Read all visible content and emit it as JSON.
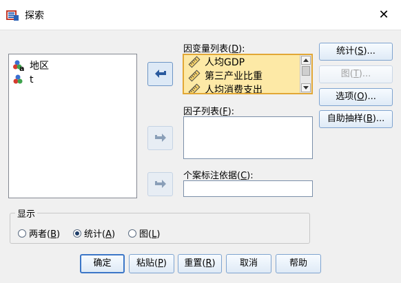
{
  "window": {
    "title": "探索",
    "close_glyph": "✕"
  },
  "source_list": {
    "items": [
      {
        "label": "地区",
        "icon": "nominal-string-variable-icon"
      },
      {
        "label": "t",
        "icon": "nominal-variable-icon"
      }
    ]
  },
  "dependent": {
    "label_pre": "因变量列表(",
    "label_key": "D",
    "label_post": "):",
    "items": [
      {
        "label": "人均GDP",
        "icon": "scale-variable-icon"
      },
      {
        "label": "第三产业比重",
        "icon": "scale-variable-icon"
      },
      {
        "label": "人均消费支出",
        "icon": "scale-variable-icon"
      }
    ]
  },
  "factor": {
    "label_pre": "因子列表(",
    "label_key": "F",
    "label_post": "):"
  },
  "case_label": {
    "label_pre": "个案标注依据(",
    "label_key": "C",
    "label_post": "):"
  },
  "side_buttons": {
    "statistics": {
      "pre": "统计(",
      "key": "S",
      "post": ")..."
    },
    "plots": {
      "pre": "图(",
      "key": "T",
      "post": ")..."
    },
    "options": {
      "pre": "选项(",
      "key": "O",
      "post": ")..."
    },
    "bootstrap": {
      "pre": "自助抽样(",
      "key": "B",
      "post": ")..."
    }
  },
  "display": {
    "title": "显示",
    "options": [
      {
        "pre": "两者(",
        "key": "B",
        "post": ")",
        "checked": false
      },
      {
        "pre": "统计(",
        "key": "A",
        "post": ")",
        "checked": true
      },
      {
        "pre": "图(",
        "key": "L",
        "post": ")",
        "checked": false
      }
    ]
  },
  "bottom_buttons": {
    "ok": "确定",
    "paste": {
      "pre": "粘贴(",
      "key": "P",
      "post": ")"
    },
    "reset": {
      "pre": "重置(",
      "key": "R",
      "post": ")"
    },
    "cancel": "取消",
    "help": "帮助"
  },
  "colors": {
    "dependent_fill": "#fde9a6",
    "dependent_border": "#e2a735",
    "arrow_blue": "#2a5a9e"
  }
}
